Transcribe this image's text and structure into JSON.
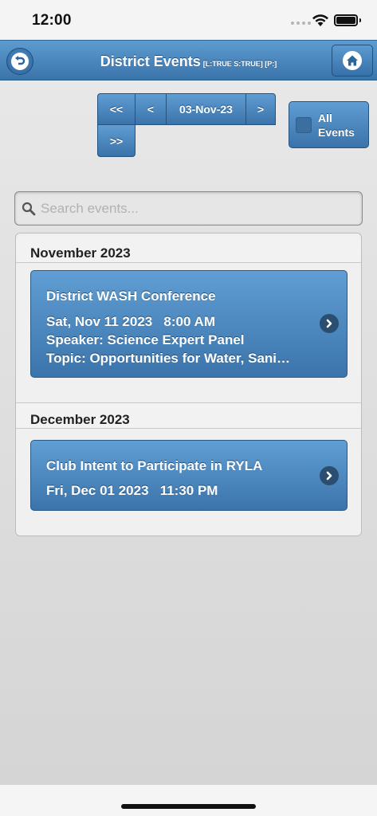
{
  "status_bar": {
    "time": "12:00"
  },
  "header": {
    "title": "District Events",
    "meta": "[L:TRUE S:TRUE] [P:]"
  },
  "nav": {
    "first_label": "<<",
    "prev_label": "<",
    "date_label": "03-Nov-23",
    "next_label": ">",
    "last_label": ">>",
    "all_events_line1": "All",
    "all_events_line2": "Events"
  },
  "search": {
    "placeholder": "Search events..."
  },
  "groups": [
    {
      "heading": "November 2023",
      "events": [
        {
          "title": "District WASH Conference",
          "datetime": "Sat, Nov 11 2023   8:00 AM",
          "speaker": "Speaker: Science Expert Panel",
          "topic": "Topic: Opportunities for Water, Sani…"
        }
      ]
    },
    {
      "heading": "December 2023",
      "events": [
        {
          "title": "Club Intent to Participate in RYLA",
          "datetime": "Fri, Dec 01 2023   11:30 PM"
        }
      ]
    }
  ],
  "colors": {
    "header_blue": "#4a87be",
    "button_blue": "#4f8bc2",
    "background": "#e3e3e3"
  }
}
